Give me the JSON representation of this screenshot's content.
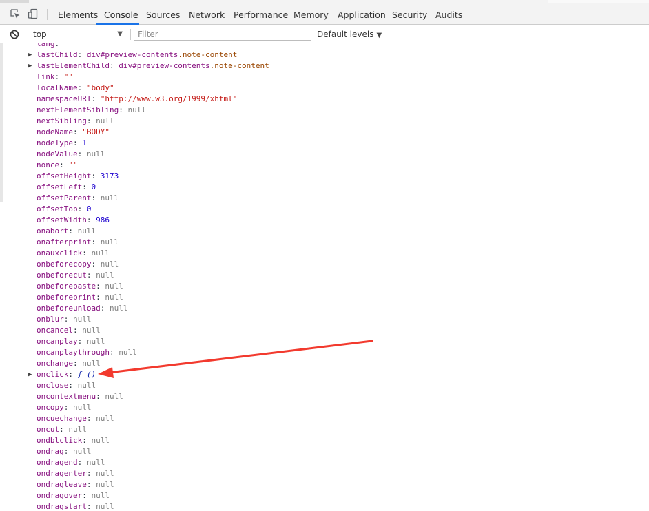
{
  "tabs": [
    {
      "label": "Elements"
    },
    {
      "label": "Console"
    },
    {
      "label": "Sources"
    },
    {
      "label": "Network"
    },
    {
      "label": "Performance"
    },
    {
      "label": "Memory"
    },
    {
      "label": "Application"
    },
    {
      "label": "Security"
    },
    {
      "label": "Audits"
    }
  ],
  "active_tab": "Console",
  "toolbar": {
    "context": "top",
    "filter_placeholder": "Filter",
    "levels_label": "Default levels"
  },
  "colors": {
    "accent": "#1a73e8",
    "annotation_arrow": "#f23a2e"
  },
  "icons": [
    "inspect-element-icon",
    "device-toggle-icon",
    "clear-console-icon",
    "dropdown-arrow-icon",
    "expand-triangle-icon"
  ],
  "console_rows": [
    {
      "key": "lang",
      "sep": ": ",
      "value": "\"\"",
      "type": "str",
      "expandable": false
    },
    {
      "key": "lastChild",
      "sep": ": ",
      "value": "div#preview-contents",
      "cls": ".note-content",
      "type": "node",
      "expandable": true
    },
    {
      "key": "lastElementChild",
      "sep": ": ",
      "value": "div#preview-contents",
      "cls": ".note-content",
      "type": "node",
      "expandable": true
    },
    {
      "key": "link",
      "sep": ": ",
      "value": "\"\"",
      "type": "str",
      "expandable": false
    },
    {
      "key": "localName",
      "sep": ": ",
      "value": "\"body\"",
      "type": "str",
      "expandable": false
    },
    {
      "key": "namespaceURI",
      "sep": ": ",
      "value": "\"http://www.w3.org/1999/xhtml\"",
      "type": "str",
      "expandable": false
    },
    {
      "key": "nextElementSibling",
      "sep": ": ",
      "value": "null",
      "type": "null",
      "expandable": false
    },
    {
      "key": "nextSibling",
      "sep": ": ",
      "value": "null",
      "type": "null",
      "expandable": false
    },
    {
      "key": "nodeName",
      "sep": ": ",
      "value": "\"BODY\"",
      "type": "str",
      "expandable": false
    },
    {
      "key": "nodeType",
      "sep": ": ",
      "value": "1",
      "type": "num",
      "expandable": false
    },
    {
      "key": "nodeValue",
      "sep": ": ",
      "value": "null",
      "type": "null",
      "expandable": false
    },
    {
      "key": "nonce",
      "sep": ": ",
      "value": "\"\"",
      "type": "str",
      "expandable": false
    },
    {
      "key": "offsetHeight",
      "sep": ": ",
      "value": "3173",
      "type": "num",
      "expandable": false
    },
    {
      "key": "offsetLeft",
      "sep": ": ",
      "value": "0",
      "type": "num",
      "expandable": false
    },
    {
      "key": "offsetParent",
      "sep": ": ",
      "value": "null",
      "type": "null",
      "expandable": false
    },
    {
      "key": "offsetTop",
      "sep": ": ",
      "value": "0",
      "type": "num",
      "expandable": false
    },
    {
      "key": "offsetWidth",
      "sep": ": ",
      "value": "986",
      "type": "num",
      "expandable": false
    },
    {
      "key": "onabort",
      "sep": ": ",
      "value": "null",
      "type": "null",
      "expandable": false
    },
    {
      "key": "onafterprint",
      "sep": ": ",
      "value": "null",
      "type": "null",
      "expandable": false
    },
    {
      "key": "onauxclick",
      "sep": ": ",
      "value": "null",
      "type": "null",
      "expandable": false
    },
    {
      "key": "onbeforecopy",
      "sep": ": ",
      "value": "null",
      "type": "null",
      "expandable": false
    },
    {
      "key": "onbeforecut",
      "sep": ": ",
      "value": "null",
      "type": "null",
      "expandable": false
    },
    {
      "key": "onbeforepaste",
      "sep": ": ",
      "value": "null",
      "type": "null",
      "expandable": false
    },
    {
      "key": "onbeforeprint",
      "sep": ": ",
      "value": "null",
      "type": "null",
      "expandable": false
    },
    {
      "key": "onbeforeunload",
      "sep": ": ",
      "value": "null",
      "type": "null",
      "expandable": false
    },
    {
      "key": "onblur",
      "sep": ": ",
      "value": "null",
      "type": "null",
      "expandable": false
    },
    {
      "key": "oncancel",
      "sep": ": ",
      "value": "null",
      "type": "null",
      "expandable": false
    },
    {
      "key": "oncanplay",
      "sep": ": ",
      "value": "null",
      "type": "null",
      "expandable": false
    },
    {
      "key": "oncanplaythrough",
      "sep": ": ",
      "value": "null",
      "type": "null",
      "expandable": false
    },
    {
      "key": "onchange",
      "sep": ": ",
      "value": "null",
      "type": "null",
      "expandable": false
    },
    {
      "key": "onclick",
      "sep": ": ",
      "value": "ƒ ()",
      "type": "fn",
      "expandable": true
    },
    {
      "key": "onclose",
      "sep": ": ",
      "value": "null",
      "type": "null",
      "expandable": false
    },
    {
      "key": "oncontextmenu",
      "sep": ": ",
      "value": "null",
      "type": "null",
      "expandable": false
    },
    {
      "key": "oncopy",
      "sep": ": ",
      "value": "null",
      "type": "null",
      "expandable": false
    },
    {
      "key": "oncuechange",
      "sep": ": ",
      "value": "null",
      "type": "null",
      "expandable": false
    },
    {
      "key": "oncut",
      "sep": ": ",
      "value": "null",
      "type": "null",
      "expandable": false
    },
    {
      "key": "ondblclick",
      "sep": ": ",
      "value": "null",
      "type": "null",
      "expandable": false
    },
    {
      "key": "ondrag",
      "sep": ": ",
      "value": "null",
      "type": "null",
      "expandable": false
    },
    {
      "key": "ondragend",
      "sep": ": ",
      "value": "null",
      "type": "null",
      "expandable": false
    },
    {
      "key": "ondragenter",
      "sep": ": ",
      "value": "null",
      "type": "null",
      "expandable": false
    },
    {
      "key": "ondragleave",
      "sep": ": ",
      "value": "null",
      "type": "null",
      "expandable": false
    },
    {
      "key": "ondragover",
      "sep": ": ",
      "value": "null",
      "type": "null",
      "expandable": false
    },
    {
      "key": "ondragstart",
      "sep": ": ",
      "value": "null",
      "type": "null",
      "expandable": false
    }
  ]
}
